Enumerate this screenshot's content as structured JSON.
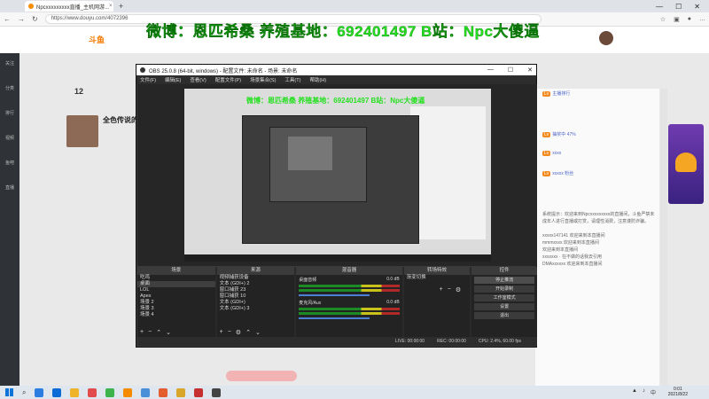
{
  "browser": {
    "tab_title": "Npcxxxxxxxxx直播_主机网游...",
    "tab_close": "×",
    "new_tab": "+",
    "url": "https://www.douyu.com/4072396",
    "window_controls": [
      "—",
      "☐",
      "✕"
    ]
  },
  "banner": {
    "text": "微博：恩匹希桑 养殖基地：692401497 B站：Npc大傻逼"
  },
  "page": {
    "logo": "斗鱼",
    "follow_count": "12",
    "stream_title": "全色传说的",
    "left_nav": [
      "关注",
      "分类",
      "排行",
      "视频",
      "鱼吧",
      "直播"
    ],
    "right_rows": [
      {
        "badge": "Lv",
        "text": "主播排行"
      },
      {
        "badge": "Lv",
        "text": "抽奖中 47%"
      },
      {
        "badge": "Lv",
        "text": "xxxx"
      },
      {
        "badge": "Lv",
        "text": "xxxxx 粉丝"
      }
    ],
    "chat_text": "系统提示：欢迎来到Npcxxxxxxxxx的直播间，斗鱼严禁未成年人进行直播或打赏，请理性消费，注意谨防诈骗。",
    "chat_lines": [
      "xxxxx147141 欢迎来到本直播间",
      "mmmxxxx 欢迎来到本直播间",
      "欢迎来到本直播间",
      "xxxxxxx · 在不做的话我去引用",
      "DMAxxxxxx 欢迎来到本直播间"
    ]
  },
  "obs": {
    "title": "OBS 25.0.8 (64-bit, windows) - 配置文件: 未命名 - 场景: 未命名",
    "menu": [
      "文件(F)",
      "编辑(E)",
      "查看(V)",
      "配置文件(P)",
      "场景集合(S)",
      "工具(T)",
      "帮助(H)"
    ],
    "docks": {
      "scenes": {
        "header": "场景",
        "items": [
          "吃鸡",
          "桌面",
          "LOL",
          "Apex",
          "场景 2",
          "场景 3",
          "场景 4"
        ],
        "selected": 1
      },
      "sources": {
        "header": "来源",
        "items": [
          "视频捕获设备",
          "文本 (GDI+) 2",
          "窗口捕获 23",
          "窗口捕获 10",
          "文本 (GDI+)",
          "文本 (GDI+) 3"
        ]
      },
      "mixer": {
        "header": "混音器",
        "channels": [
          {
            "name": "桌面音频",
            "level": "0.0 dB"
          },
          {
            "name": "麦克风/Aux",
            "level": "0.0 dB"
          }
        ]
      },
      "transitions": {
        "header": "转场特效",
        "value": "渐变切换"
      },
      "controls": {
        "header": "控件",
        "buttons": [
          "停止推流",
          "开始录制",
          "工作室模式",
          "设置",
          "退出"
        ]
      }
    },
    "status": [
      "LIVE: 00:00:00",
      "REC: 00:00:00",
      "CPU: 2.4%, 60.00 fps"
    ]
  },
  "taskbar": {
    "time": "0:01",
    "date": "2021/8/22",
    "tray_lang": "中"
  }
}
